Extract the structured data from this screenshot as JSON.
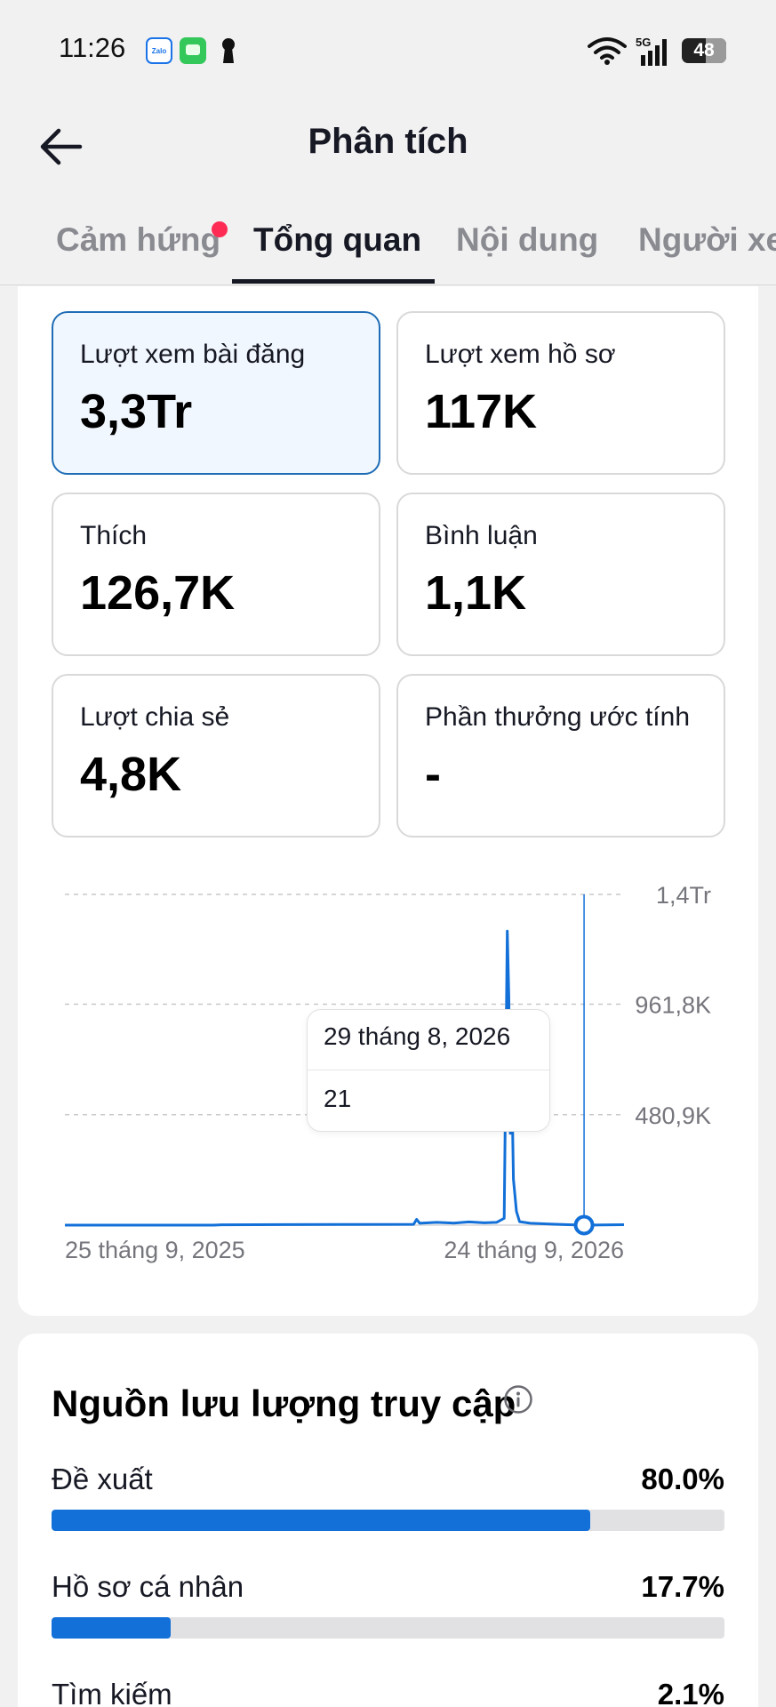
{
  "status_bar": {
    "time": "11:26",
    "zalo_text": "Zalo",
    "network": "5G",
    "battery": "48"
  },
  "header": {
    "title": "Phân tích"
  },
  "tabs": [
    {
      "label": "Cảm hứng",
      "has_dot": true
    },
    {
      "label": "Tổng quan",
      "active": true
    },
    {
      "label": "Nội dung"
    },
    {
      "label": "Người xem"
    }
  ],
  "metrics": [
    {
      "label": "Lượt xem bài đăng",
      "value": "3,3Tr",
      "selected": true
    },
    {
      "label": "Lượt xem hồ sơ",
      "value": "117K"
    },
    {
      "label": "Thích",
      "value": "126,7K"
    },
    {
      "label": "Bình luận",
      "value": "1,1K"
    },
    {
      "label": "Lượt chia sẻ",
      "value": "4,8K"
    },
    {
      "label": "Phần thưởng ước tính",
      "value": "-"
    }
  ],
  "chart_data": {
    "type": "line",
    "y_ticks": [
      "1,4Tr",
      "961,8K",
      "480,9K"
    ],
    "y_tick_values": [
      1440000,
      961800,
      480900
    ],
    "ylim": [
      0,
      1440000
    ],
    "x_labels": [
      "25 tháng 9, 2025",
      "24 tháng 9, 2026"
    ],
    "x_range": [
      "2025-09-25",
      "2026-09-24"
    ],
    "grid": true,
    "color": "#1270d8",
    "series": [
      {
        "points": [
          [
            "2025-09-25",
            0
          ],
          [
            "2025-12-31",
            0
          ],
          [
            "2026-01-05",
            1500
          ],
          [
            "2026-02-15",
            2500
          ],
          [
            "2026-04-01",
            3000
          ],
          [
            "2026-05-10",
            3500
          ],
          [
            "2026-05-12",
            25000
          ],
          [
            "2026-05-14",
            8000
          ],
          [
            "2026-05-25",
            12000
          ],
          [
            "2026-06-05",
            9000
          ],
          [
            "2026-06-15",
            14000
          ],
          [
            "2026-06-25",
            10000
          ],
          [
            "2026-07-03",
            12000
          ],
          [
            "2026-07-08",
            30000
          ],
          [
            "2026-07-10",
            1280000
          ],
          [
            "2026-07-11",
            1000000
          ],
          [
            "2026-07-12",
            400000
          ],
          [
            "2026-07-13",
            600000
          ],
          [
            "2026-07-14",
            200000
          ],
          [
            "2026-07-16",
            60000
          ],
          [
            "2026-07-18",
            15000
          ],
          [
            "2026-07-25",
            8000
          ],
          [
            "2026-08-10",
            4000
          ],
          [
            "2026-08-29",
            21
          ],
          [
            "2026-09-24",
            2000
          ]
        ]
      }
    ],
    "highlight": {
      "date": "29 tháng 8, 2026",
      "x": "2026-08-29",
      "value": "21"
    }
  },
  "traffic": {
    "title": "Nguồn lưu lượng truy cập",
    "sources": [
      {
        "name": "Đề xuất",
        "pct_label": "80.0%",
        "pct": 80.0
      },
      {
        "name": "Hồ sơ cá nhân",
        "pct_label": "17.7%",
        "pct": 17.7
      },
      {
        "name": "Tìm kiếm",
        "pct_label": "2.1%",
        "pct": 2.1
      }
    ]
  },
  "colors": {
    "accent": "#1270d8",
    "selected_border": "#1f6db5",
    "selected_bg": "#f1f7fe",
    "notification_dot": "#fe2c55"
  }
}
